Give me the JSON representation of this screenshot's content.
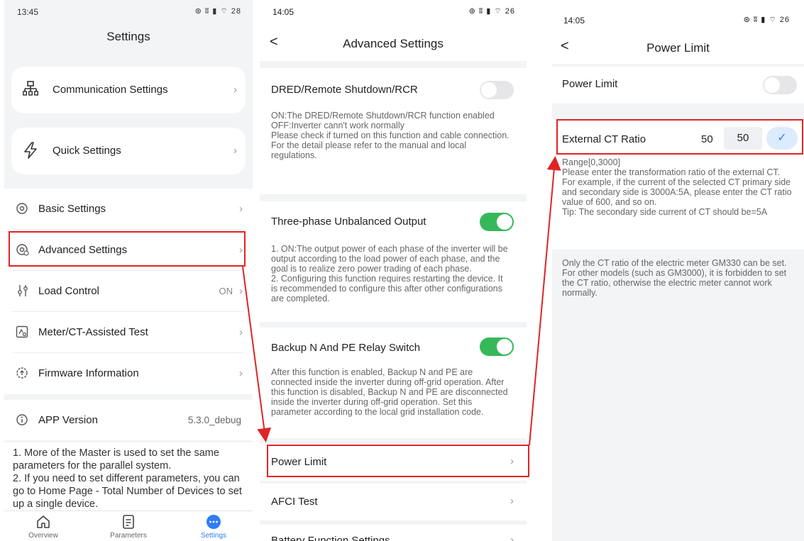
{
  "settings": {
    "time": "13:45",
    "status_icons": "⊛ ʬ ▮ ⌔ 28",
    "title": "Settings",
    "cards": [
      {
        "label": "Communication Settings",
        "icon": "network-icon"
      },
      {
        "label": "Quick Settings",
        "icon": "lightning-icon"
      }
    ],
    "items": [
      {
        "label": "Basic Settings",
        "value": "",
        "icon": "gear-icon"
      },
      {
        "label": "Advanced Settings",
        "value": "",
        "icon": "advanced-gear-icon"
      },
      {
        "label": "Load Control",
        "value": "ON",
        "icon": "slider-icon"
      },
      {
        "label": "Meter/CT-Assisted Test",
        "value": "",
        "icon": "meter-icon"
      },
      {
        "label": "Firmware Information",
        "value": "",
        "icon": "firmware-icon"
      }
    ],
    "app_version": {
      "label": "APP Version",
      "value": "5.3.0_debug"
    },
    "note": "1. More of the Master is used to set the same parameters for the parallel system.\n2. If you need to set different parameters, you can go to Home Page - Total Number of Devices to set up a single device.",
    "nav": [
      {
        "label": "Overview",
        "icon": "home-icon"
      },
      {
        "label": "Parameters",
        "icon": "parameters-icon"
      },
      {
        "label": "Settings",
        "icon": "settings-dots-icon"
      }
    ],
    "accent": "#2f7df6"
  },
  "advanced": {
    "time": "14:05",
    "status_icons": "⊛ ʬ ▮ ⌔ 26",
    "back": "<",
    "title": "Advanced Settings",
    "dred": {
      "label": "DRED/Remote Shutdown/RCR",
      "enabled": false,
      "desc": "ON:The DRED/Remote Shutdown/RCR function enabled\nOFF:Inverter cann't work normally\nPlease check if turned on this function and cable connection.\nFor the detail please refer to the manual and local regulations."
    },
    "three_phase": {
      "label": "Three-phase Unbalanced Output",
      "enabled": true,
      "desc": "1. ON:The output power of each phase of the inverter will be output according to the load power of each phase, and the goal is to realize zero power trading of each phase.\n2. Configuring this function requires restarting the device. It is recommended to configure this after other configurations are completed."
    },
    "backup": {
      "label": "Backup N And PE Relay Switch",
      "enabled": true,
      "desc": "After this function is enabled, Backup N and PE are connected inside the inverter during off-grid operation. After this function is disabled, Backup N and PE are disconnected inside the inverter during off-grid operation. Set this parameter according to the local grid installation code."
    },
    "links": [
      {
        "label": "Power Limit"
      },
      {
        "label": "AFCI Test"
      },
      {
        "label": "Battery Function Settings"
      }
    ],
    "toggle_on_color": "#36b85a"
  },
  "power_limit": {
    "time": "14:05",
    "status_icons": "⊛ ʬ ▮ ⌔ 26",
    "back": "<",
    "title": "Power Limit",
    "switch_label": "Power Limit",
    "enabled": false,
    "ct_label": "External CT Ratio",
    "ct_value": "50",
    "ct_input": "50",
    "ct_confirm": "✓",
    "range_text": "Range[0,3000]\nPlease enter the transformation ratio of the external CT. For example, if the current of the selected CT primary side and secondary side is 3000A:5A, please enter the CT ratio value of 600, and so on.\nTip: The secondary side current of CT should be=5A",
    "note": "Only the CT ratio of the electric meter GM330 can be set. For other models (such as GM3000), it is forbidden to set the CT ratio, otherwise the electric meter cannot work normally."
  },
  "annotation_color": "#e02424"
}
